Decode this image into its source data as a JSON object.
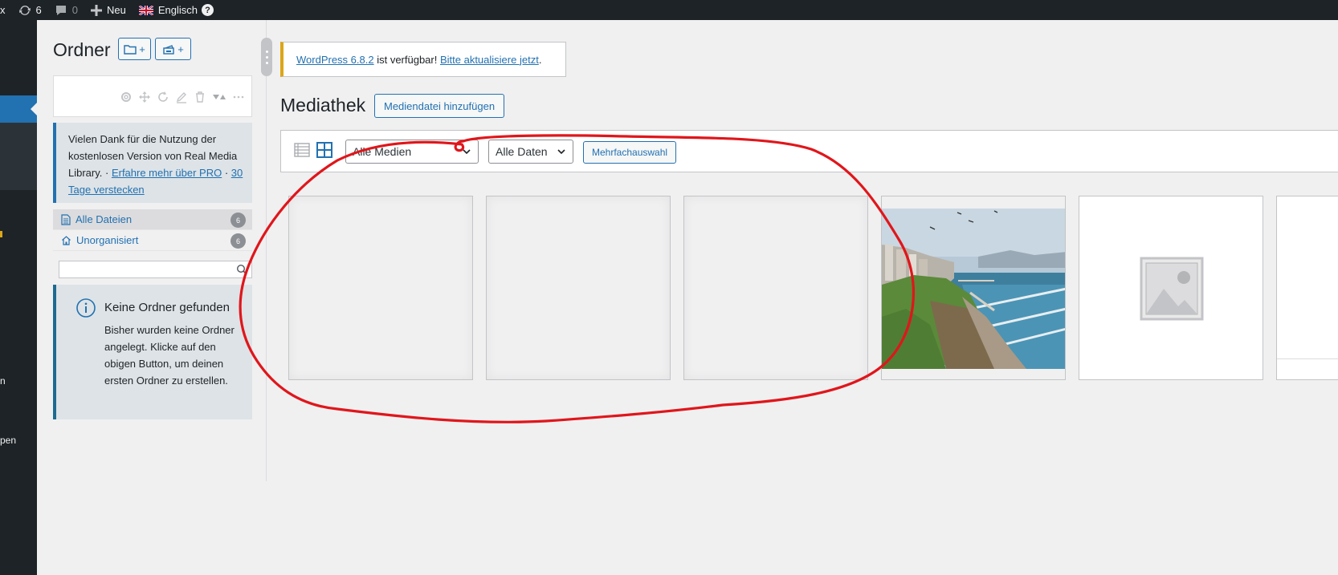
{
  "adminbar": {
    "left_fragment": "x",
    "updates_count": "6",
    "comments_count": "0",
    "new_label": "Neu",
    "language_label": "Englisch",
    "help_label": "?"
  },
  "adminmenu": {
    "fragments": [
      "n",
      "pen"
    ]
  },
  "folders": {
    "title": "Ordner",
    "btn_folder_plus": "+",
    "btn_collection_plus": "+",
    "thanks_text": "Vielen Dank für die Nutzung der kostenlosen Version von Real Media Library. · ",
    "thanks_link_more": "Erfahre mehr über PRO",
    "thanks_separator": " · ",
    "thanks_link_hide": "30 Tage verstecken",
    "tree": [
      {
        "label": "Alle Dateien",
        "count": "6"
      },
      {
        "label": "Unorganisiert",
        "count": "6"
      }
    ],
    "search_placeholder": "",
    "empty_title": "Keine Ordner gefunden",
    "empty_text": "Bisher wurden keine Ordner angelegt. Klicke auf den obigen Button, um deinen ersten Ordner zu erstellen."
  },
  "notice": {
    "link_version": "WordPress 6.8.2",
    "middle_text": " ist verfügbar! ",
    "link_update": "Bitte aktualisiere jetzt",
    "end_text": "."
  },
  "main": {
    "title": "Mediathek",
    "add_button": "Mediendatei hinzufügen",
    "filter_media": "Alle Medien",
    "filter_dates": "Alle Daten",
    "multi_select": "Mehrfachauswahl",
    "attachments": [
      {
        "type": "loading"
      },
      {
        "type": "loading"
      },
      {
        "type": "loading"
      },
      {
        "type": "photo"
      },
      {
        "type": "placeholder"
      },
      {
        "type": "file",
        "filename": "wpml-sup"
      }
    ]
  },
  "colors": {
    "admin_dark": "#1d2327",
    "accent_blue": "#2271b1",
    "notice_warning": "#dba617",
    "annotation_red": "#e0161b"
  }
}
